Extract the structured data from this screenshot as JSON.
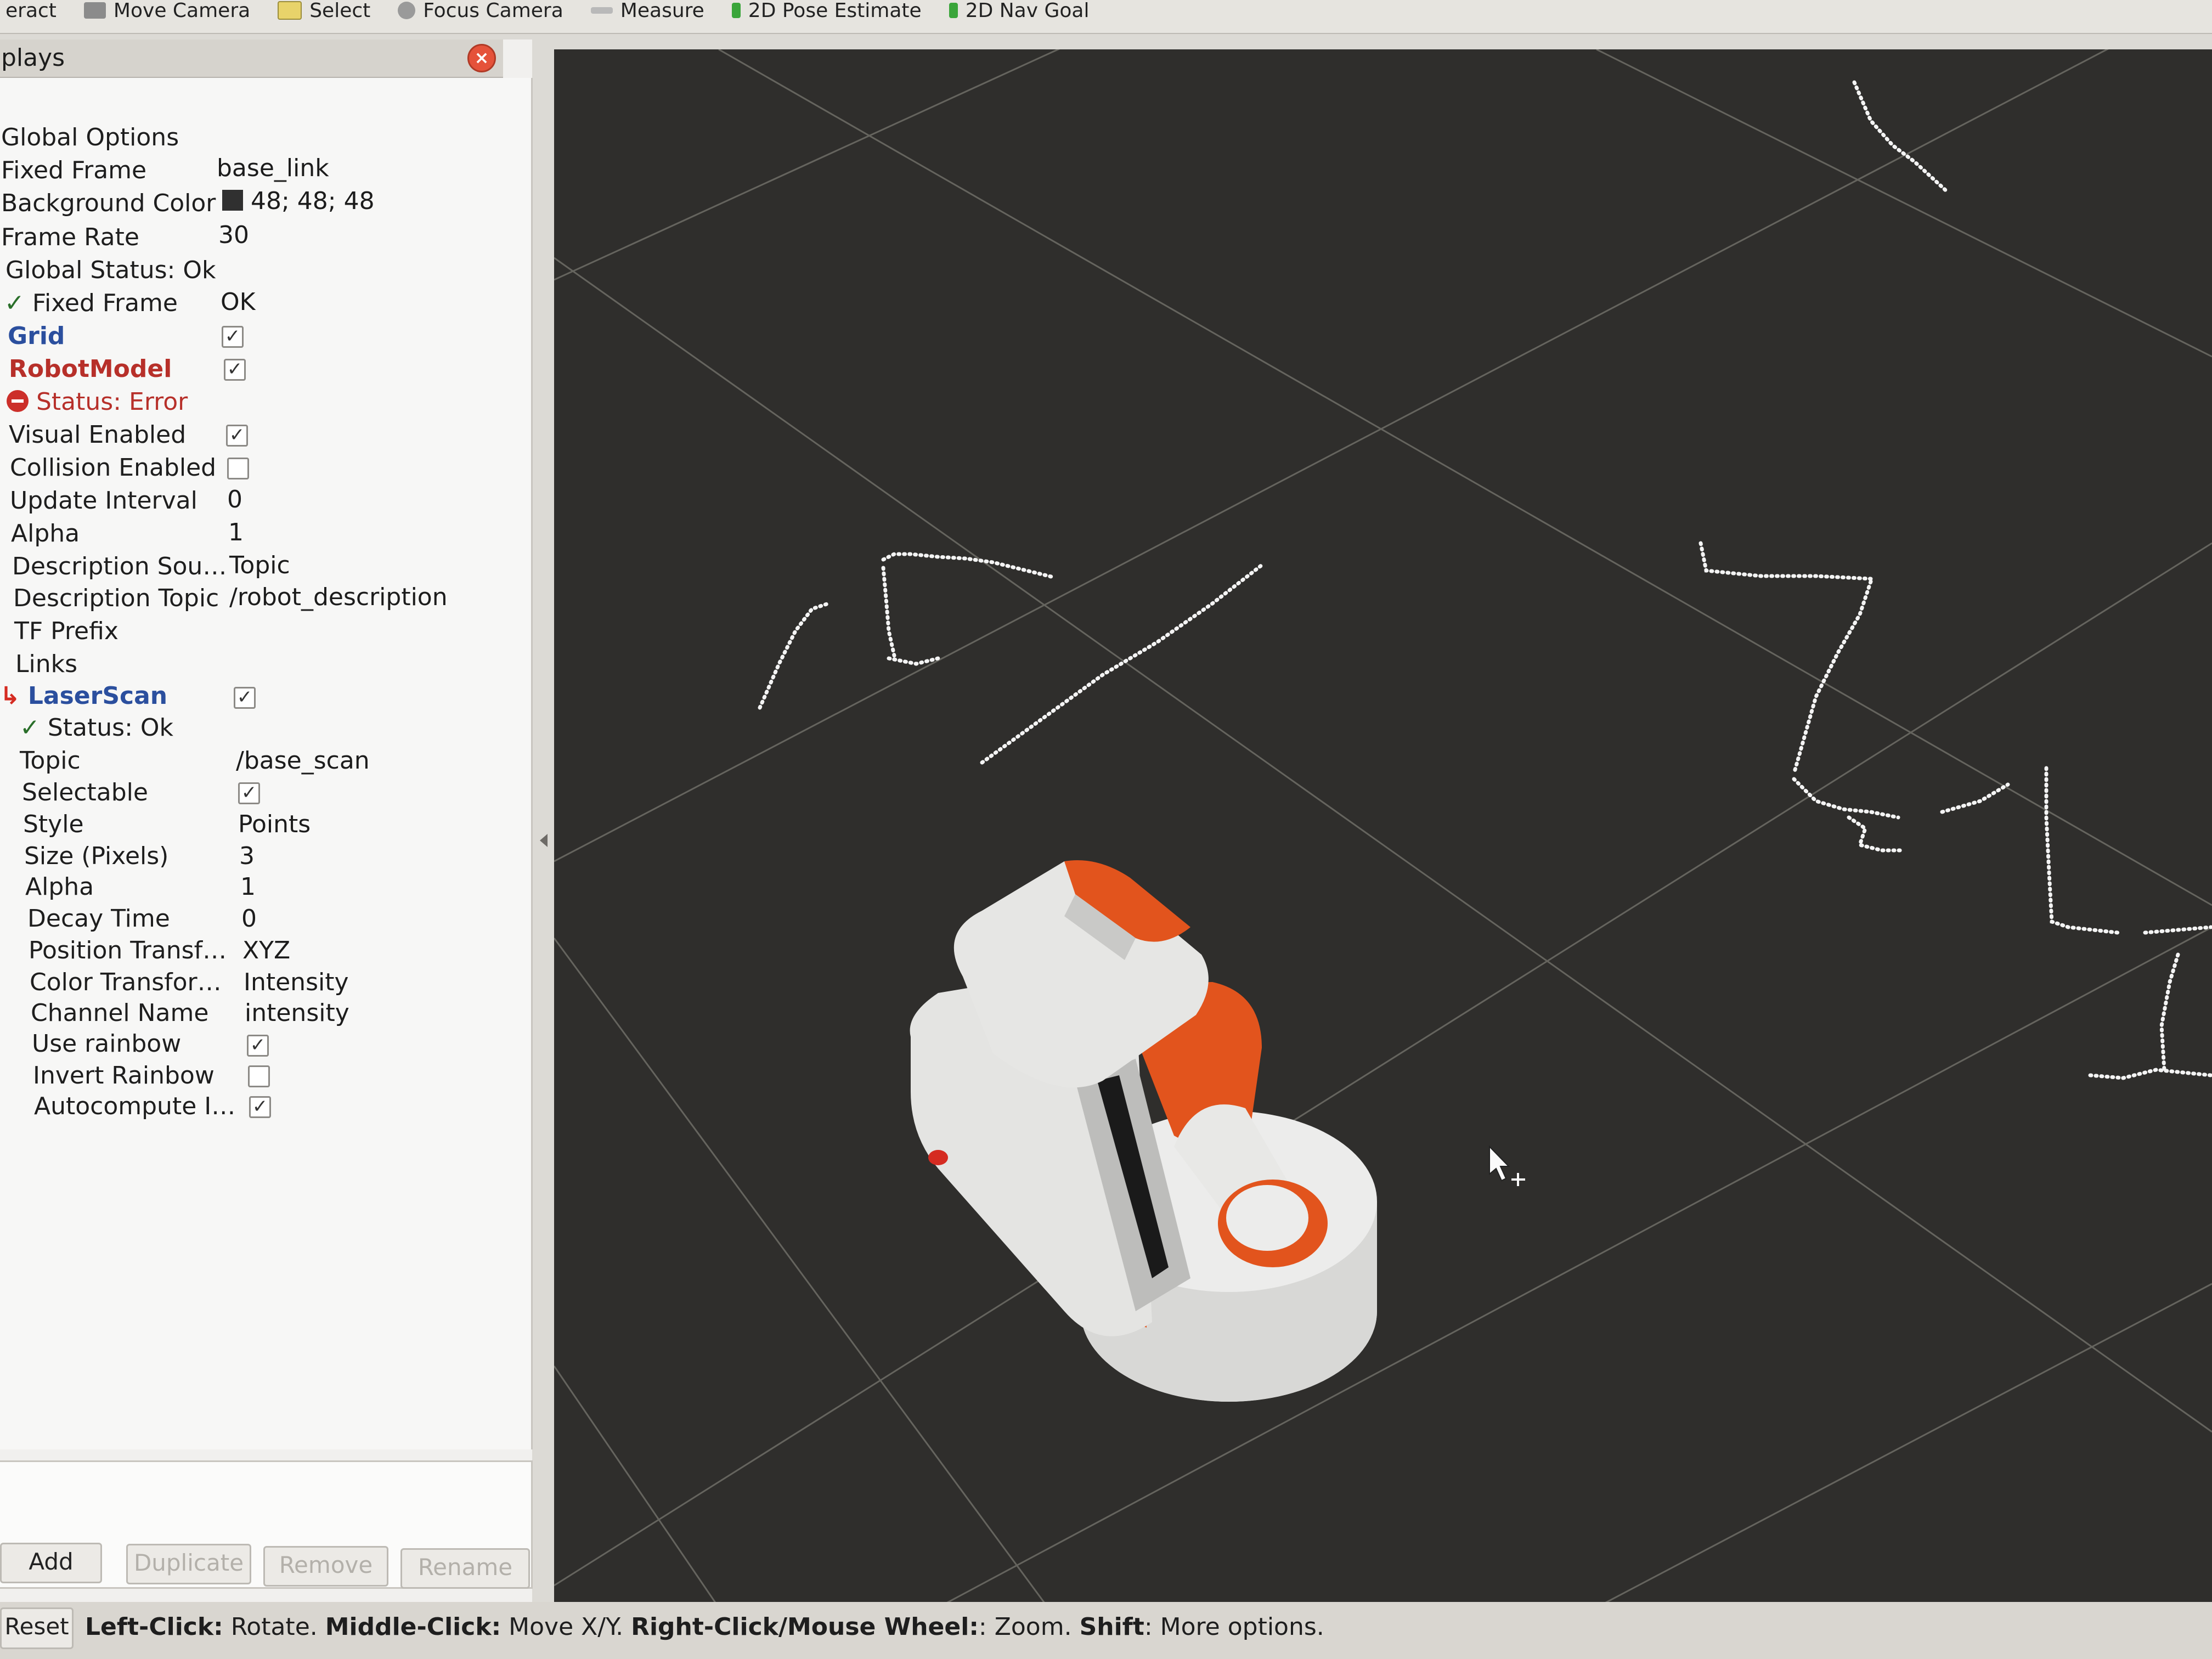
{
  "toolbar": {
    "items": [
      {
        "label": "eract",
        "icon": "interact-icon"
      },
      {
        "label": "Move Camera",
        "icon": "camera-icon"
      },
      {
        "label": "Select",
        "icon": "select-icon"
      },
      {
        "label": "Focus Camera",
        "icon": "focus-icon"
      },
      {
        "label": "Measure",
        "icon": "measure-icon"
      },
      {
        "label": "2D Pose Estimate",
        "icon": "pose-icon"
      },
      {
        "label": "2D Nav Goal",
        "icon": "goal-icon"
      }
    ]
  },
  "displays_panel": {
    "title": "plays",
    "close_icon": "close-icon",
    "rows": {
      "global_options": "Global Options",
      "fixed_frame": {
        "label": "Fixed Frame",
        "value": "base_link"
      },
      "background_color": {
        "label": "Background Color",
        "value": "48; 48; 48",
        "swatch": "#303030"
      },
      "frame_rate": {
        "label": "Frame Rate",
        "value": "30"
      },
      "global_status": "Global Status: Ok",
      "fixed_frame_status": {
        "label": "Fixed Frame",
        "value": "OK"
      },
      "grid": {
        "label": "Grid",
        "checked": true
      },
      "robot_model": {
        "label": "RobotModel",
        "checked": true,
        "status": "Status: Error",
        "visual_enabled": {
          "label": "Visual Enabled",
          "checked": true
        },
        "collision_enabled": {
          "label": "Collision Enabled",
          "checked": false
        },
        "update_interval": {
          "label": "Update Interval",
          "value": "0"
        },
        "alpha": {
          "label": "Alpha",
          "value": "1"
        },
        "description_source": {
          "label": "Description Sou…",
          "value": "Topic"
        },
        "description_topic": {
          "label": "Description Topic",
          "value": "/robot_description"
        },
        "tf_prefix": {
          "label": "TF Prefix",
          "value": ""
        },
        "links": {
          "label": "Links"
        }
      },
      "laser_scan": {
        "label": "LaserScan",
        "checked": true,
        "status": "Status: Ok",
        "topic": {
          "label": "Topic",
          "value": "/base_scan"
        },
        "selectable": {
          "label": "Selectable",
          "checked": true
        },
        "style": {
          "label": "Style",
          "value": "Points"
        },
        "size": {
          "label": "Size (Pixels)",
          "value": "3"
        },
        "alpha": {
          "label": "Alpha",
          "value": "1"
        },
        "decay_time": {
          "label": "Decay Time",
          "value": "0"
        },
        "position_transformer": {
          "label": "Position Transf…",
          "value": "XYZ"
        },
        "color_transformer": {
          "label": "Color Transfor…",
          "value": "Intensity"
        },
        "channel_name": {
          "label": "Channel Name",
          "value": "intensity"
        },
        "use_rainbow": {
          "label": "Use rainbow",
          "checked": true
        },
        "invert_rainbow": {
          "label": "Invert Rainbow",
          "checked": false
        },
        "autocompute": {
          "label": "Autocompute I…",
          "checked": true
        }
      }
    },
    "buttons": {
      "add": "Add",
      "duplicate": "Duplicate",
      "remove": "Remove",
      "rename": "Rename"
    }
  },
  "status_bar": {
    "reset": "Reset",
    "hint_left_key": "Left-Click:",
    "hint_left_action": " Rotate. ",
    "hint_middle_key": "Middle-Click:",
    "hint_middle_action": " Move X/Y. ",
    "hint_right_key": "Right-Click/Mouse Wheel:",
    "hint_right_action": ": Zoom. ",
    "hint_shift_key": "Shift",
    "hint_shift_action": ": More options."
  },
  "viewport": {
    "background": "#2f2e2c",
    "grid_color": "#7a7a78",
    "scan_color": "#f4f4f4",
    "robot_white": "#e3e3e1",
    "robot_orange": "#e2541d"
  }
}
